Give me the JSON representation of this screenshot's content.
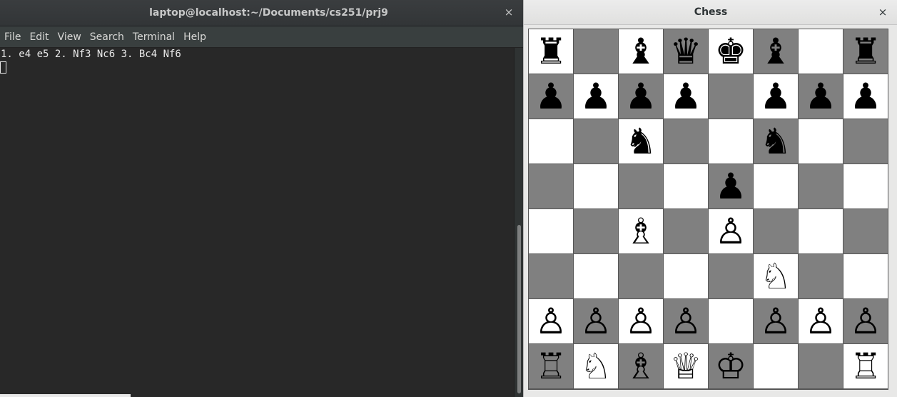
{
  "terminal": {
    "title": "laptop@localhost:~/Documents/cs251/prj9",
    "close_glyph": "×",
    "menu": [
      "File",
      "Edit",
      "View",
      "Search",
      "Terminal",
      "Help"
    ],
    "output_line": "1. e4 e5 2. Nf3 Nc6 3. Bc4 Nf6",
    "scroll_position": 1.0
  },
  "chess": {
    "title": "Chess",
    "close_glyph": "×",
    "board": [
      [
        "♜",
        "",
        "♝",
        "♛",
        "♚",
        "♝",
        "",
        "♜"
      ],
      [
        "♟",
        "♟",
        "♟",
        "♟",
        "",
        "♟",
        "♟",
        "♟"
      ],
      [
        "",
        "",
        "♞",
        "",
        "",
        "♞",
        "",
        ""
      ],
      [
        "",
        "",
        "",
        "",
        "♟",
        "",
        "",
        ""
      ],
      [
        "",
        "",
        "♗",
        "",
        "♙",
        "",
        "",
        ""
      ],
      [
        "",
        "",
        "",
        "",
        "",
        "♘",
        "",
        ""
      ],
      [
        "♙",
        "♙",
        "♙",
        "♙",
        "",
        "♙",
        "♙",
        "♙"
      ],
      [
        "♖",
        "♘",
        "♗",
        "♕",
        "♔",
        "",
        "",
        "♖"
      ]
    ],
    "square_colors": {
      "light": "#ffffff",
      "dark": "#808080"
    }
  }
}
